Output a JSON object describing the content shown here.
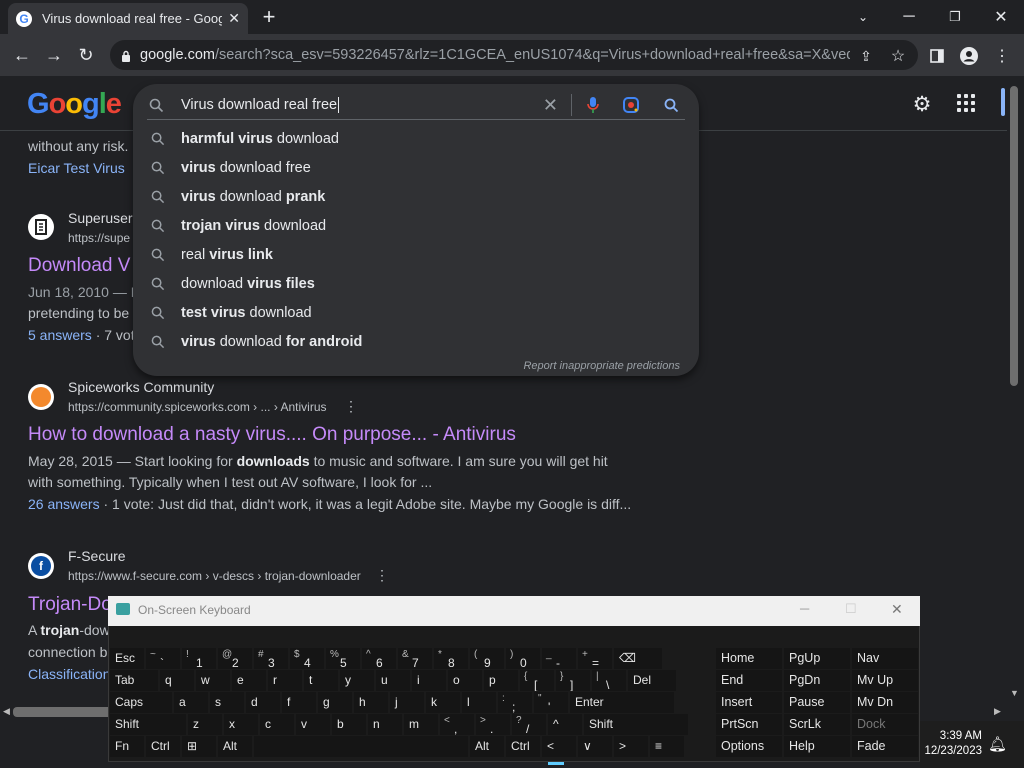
{
  "browser": {
    "tab_title": "Virus download real free - Googl",
    "url_domain": "google.com",
    "url_path": "/search?sca_esv=593226457&rlz=1C1GCEA_enUS1074&q=Virus+download+real+free&sa=X&ved=..."
  },
  "search": {
    "query": "Virus download real free",
    "suggestions": [
      {
        "pre": "",
        "bold": "harmful",
        "mid": " ",
        "bold2": "virus",
        "post": " download"
      },
      {
        "pre": "",
        "bold": "virus",
        "mid": " download free",
        "bold2": "",
        "post": ""
      },
      {
        "pre": "",
        "bold": "virus",
        "mid": " download ",
        "bold2": "prank",
        "post": ""
      },
      {
        "pre": "",
        "bold": "trojan",
        "mid": " ",
        "bold2": "virus",
        "post": " download"
      },
      {
        "pre": "real ",
        "bold": "virus link",
        "mid": "",
        "bold2": "",
        "post": ""
      },
      {
        "pre": "download ",
        "bold": "virus files",
        "mid": "",
        "bold2": "",
        "post": ""
      },
      {
        "pre": "",
        "bold": "test",
        "mid": " ",
        "bold2": "virus",
        "post": " download"
      },
      {
        "pre": "",
        "bold": "virus",
        "mid": " download ",
        "bold2": "for android",
        "post": ""
      }
    ],
    "report_label": "Report inappropriate predictions"
  },
  "results": {
    "top": {
      "snippet": "without any risk.",
      "link": "Eicar Test Virus"
    },
    "superuser": {
      "site": "Superuser",
      "url": "https://supe",
      "title": "Download V",
      "date": "Jun 18, 2010 — D",
      "snippet2": "pretending to be",
      "answers": "5 answers",
      "votes": " · 7 vot"
    },
    "spiceworks": {
      "site": "Spiceworks Community",
      "url": "https://community.spiceworks.com › ... › Antivirus",
      "title": "How to download a nasty virus.... On purpose... - Antivirus",
      "line1_pre": "May 28, 2015 — Start looking for ",
      "line1_bold": "downloads",
      "line1_post": " to music and software. I am sure you will get hit",
      "line2": "with something. Typically when I test out AV software, I look for ...",
      "answers": "26 answers",
      "votes": " · 1 vote: Just did that, didn't work, it was a legit Adobe site. Maybe my Google is diff..."
    },
    "fsecure": {
      "site": "F-Secure",
      "url": "https://www.f-secure.com › v-descs › trojan-downloader",
      "title": "Trojan-Do",
      "snip_pre": "A ",
      "snip_bold": "trojan",
      "snip_post": "-dow",
      "snip2": "connection b",
      "link": "Classification"
    }
  },
  "osk": {
    "title": "On-Screen Keyboard",
    "row1": [
      "Esc",
      "~`",
      "!1",
      "@2",
      "#3",
      "$4",
      "%5",
      "^6",
      "&7",
      "*8",
      "(9",
      ")0",
      "_-",
      "+=",
      "⌫"
    ],
    "row2": [
      "Tab",
      "q",
      "w",
      "e",
      "r",
      "t",
      "y",
      "u",
      "i",
      "o",
      "p",
      "{[",
      "}]",
      "|\\",
      "Del"
    ],
    "row3": [
      "Caps",
      "a",
      "s",
      "d",
      "f",
      "g",
      "h",
      "j",
      "k",
      "l",
      ":;",
      "\"'",
      "Enter"
    ],
    "row4": [
      "Shift",
      "z",
      "x",
      "c",
      "v",
      "b",
      "n",
      "m",
      "<,",
      ">.",
      "?/",
      "^",
      "Shift"
    ],
    "row5": [
      "Fn",
      "Ctrl",
      "⊞",
      "Alt",
      "",
      "Alt",
      "Ctrl",
      "<",
      "∨",
      ">",
      "≡"
    ],
    "nav": [
      [
        "Home",
        "PgUp",
        "Nav"
      ],
      [
        "End",
        "PgDn",
        "Mv Up"
      ],
      [
        "Insert",
        "Pause",
        "Mv Dn"
      ],
      [
        "PrtScn",
        "ScrLk",
        "Dock"
      ],
      [
        "Options",
        "Help",
        "Fade"
      ]
    ]
  },
  "taskbar": {
    "time": "3:39 AM",
    "date": "12/23/2023"
  },
  "icons": [
    "google-favicon",
    "close-icon",
    "plus-icon",
    "back-icon",
    "forward-icon",
    "reload-icon",
    "lock-icon",
    "share-icon",
    "star-icon",
    "sidepanel-icon",
    "profile-icon",
    "menu-icon",
    "search-icon",
    "clear-icon",
    "mic-icon",
    "lens-icon",
    "gear-icon",
    "apps-icon",
    "notification-icon"
  ]
}
